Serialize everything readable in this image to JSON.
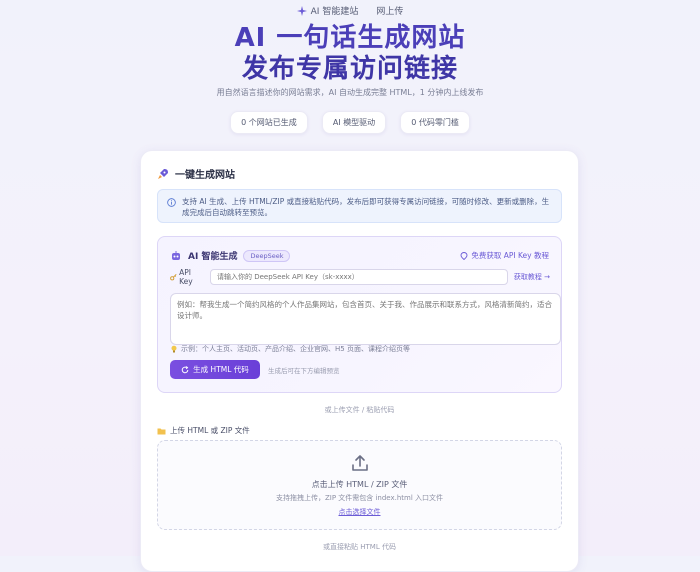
{
  "topbar": {
    "nav_ai": "AI 智能建站",
    "nav_upload": "网上传"
  },
  "hero": {
    "title_line1": "AI 一句话生成网站",
    "title_line2": "发布专属访问链接",
    "subtitle": "用自然语言描述你的网站需求，AI 自动生成完整 HTML，1 分钟内上线发布"
  },
  "chips": [
    "0 个网站已生成",
    "AI 模型驱动",
    "0 代码零门槛"
  ],
  "card": {
    "title": "一键生成网站",
    "info": "支持 AI 生成、上传 HTML/ZIP 或直接粘贴代码，发布后即可获得专属访问链接，可随时修改、更新或删除，生成完成后自动跳转至预览。"
  },
  "ai": {
    "title": "AI 智能生成",
    "badge": "DeepSeek",
    "link": "免费获取 API Key 教程",
    "key_label": "API Key",
    "key_placeholder": "请输入你的 DeepSeek API Key（sk-xxxx）",
    "key_action": "获取教程 →",
    "prompt_placeholder": "例如：帮我生成一个简约风格的个人作品集网站，包含首页、关于我、作品展示和联系方式，风格清新简约，适合设计师。",
    "hint": "示例：个人主页、活动页、产品介绍、企业官网、H5 页面、课程介绍页等",
    "generate_label": "生成 HTML 代码",
    "generate_note": "生成后可在下方编辑预览"
  },
  "divider1": "或上传文件 / 粘贴代码",
  "upload": {
    "label": "上传 HTML 或 ZIP 文件",
    "main": "点击上传 HTML / ZIP 文件",
    "sub": "支持拖拽上传，ZIP 文件需包含 index.html 入口文件",
    "link": "点击选择文件"
  },
  "divider2": "或直接粘贴 HTML 代码"
}
